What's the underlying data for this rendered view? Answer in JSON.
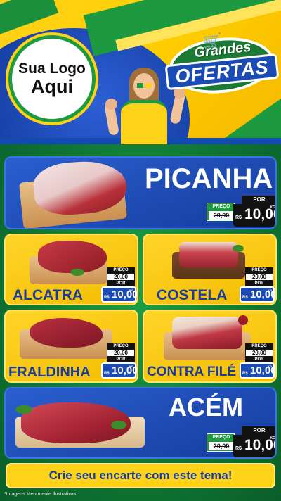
{
  "logo": {
    "line1": "Sua Logo",
    "line2": "Aqui"
  },
  "badge": {
    "line1": "Grandes",
    "line2": "OFERTAS",
    "icon": "shopping-cart-icon"
  },
  "products": [
    {
      "name": "PICANHA",
      "preco_label": "PREÇO",
      "old_price": "20,00",
      "por_label": "POR",
      "currency": "R$",
      "price": "10,00",
      "unit": "KG"
    },
    {
      "name": "ALCATRA",
      "preco_label": "PREÇO",
      "old_price": "20,00",
      "por_label": "POR",
      "currency": "R$",
      "price": "10,00",
      "unit": "KG"
    },
    {
      "name": "COSTELA",
      "preco_label": "PREÇO",
      "old_price": "20,00",
      "por_label": "POR",
      "currency": "R$",
      "price": "10,00",
      "unit": "KG"
    },
    {
      "name": "FRALDINHA",
      "preco_label": "PREÇO",
      "old_price": "20,00",
      "por_label": "POR",
      "currency": "R$",
      "price": "10,00",
      "unit": "KG"
    },
    {
      "name": "CONTRA FILÉ",
      "preco_label": "PREÇO",
      "old_price": "20,00",
      "por_label": "POR",
      "currency": "R$",
      "price": "10,00",
      "unit": "KG"
    },
    {
      "name": "ACÉM",
      "preco_label": "PREÇO",
      "old_price": "20,00",
      "por_label": "POR",
      "currency": "R$",
      "price": "10,00",
      "unit": "KG"
    }
  ],
  "cta": "Crie seu encarte com este tema!",
  "footnote": "*Imagens Meramente Ilustrativas",
  "colors": {
    "brand_blue": "#1a4ab4",
    "brand_green": "#1d9a3f",
    "brand_yellow": "#ffd21a"
  }
}
